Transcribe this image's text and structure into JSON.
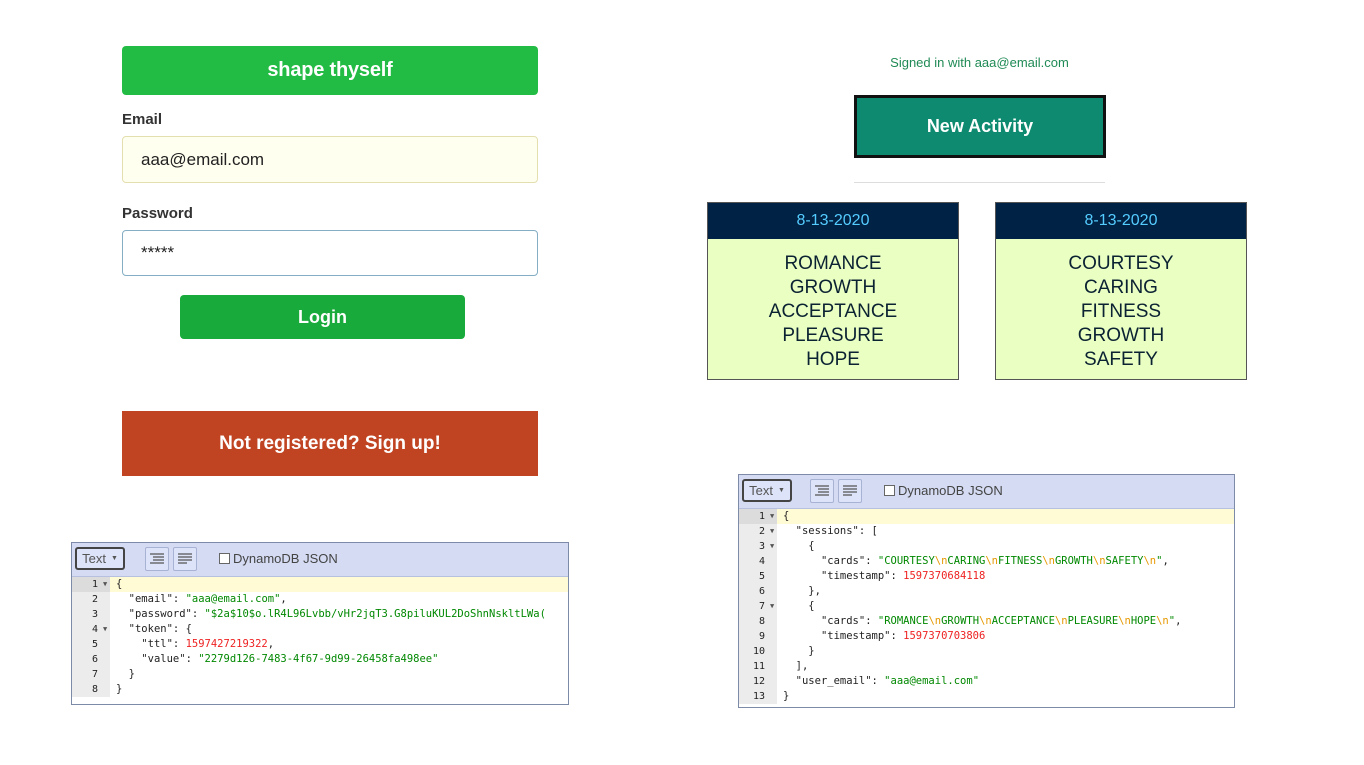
{
  "login": {
    "brand": "shape thyself",
    "email_label": "Email",
    "email_value": "aaa@email.com",
    "password_label": "Password",
    "password_value": "*****",
    "login_label": "Login",
    "signup_label": "Not registered? Sign up!"
  },
  "activity": {
    "signed_in_text": "Signed in with aaa@email.com",
    "new_activity_label": "New Activity",
    "cards": [
      {
        "date": "8-13-2020",
        "values": [
          "ROMANCE",
          "GROWTH",
          "ACCEPTANCE",
          "PLEASURE",
          "HOPE"
        ]
      },
      {
        "date": "8-13-2020",
        "values": [
          "COURTESY",
          "CARING",
          "FITNESS",
          "GROWTH",
          "SAFETY"
        ]
      }
    ]
  },
  "editors": {
    "mode_label": "Text",
    "dynamo_label": "DynamoDB JSON",
    "user_doc": {
      "email": "aaa@email.com",
      "password": "$2a$10$o.lR4L96Lvbb/vHr2jqT3.G8piluKUL2DoShnNskltLWa(",
      "ttl": "1597427219322",
      "value": "2279d126-7483-4f67-9d99-26458fa498ee"
    },
    "session_doc": {
      "session1_cards": [
        "COURTESY",
        "CARING",
        "FITNESS",
        "GROWTH",
        "SAFETY"
      ],
      "session1_timestamp": "1597370684118",
      "session2_cards": [
        "ROMANCE",
        "GROWTH",
        "ACCEPTANCE",
        "PLEASURE",
        "HOPE"
      ],
      "session2_timestamp": "1597370703806",
      "user_email": "aaa@email.com"
    }
  },
  "colors": {
    "brand_green": "#22bb44",
    "login_green": "#18aa3a",
    "signup_red": "#c04422",
    "new_activity_teal": "#0e8a70",
    "card_header": "#002244",
    "card_body": "#eaffc2"
  }
}
